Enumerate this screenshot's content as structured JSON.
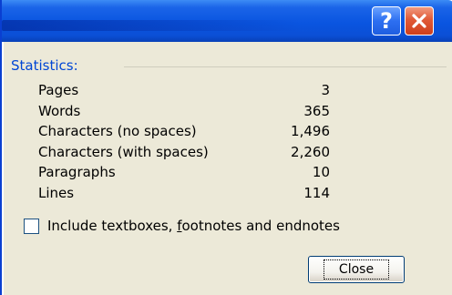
{
  "titlebar": {
    "help_label": "?",
    "close_icon": "close-x-icon"
  },
  "statistics": {
    "heading": "Statistics:",
    "rows": [
      {
        "name": "Pages",
        "value": "3"
      },
      {
        "name": "Words",
        "value": "365"
      },
      {
        "name": "Characters (no spaces)",
        "value": "1,496"
      },
      {
        "name": "Characters (with spaces)",
        "value": "2,260"
      },
      {
        "name": "Paragraphs",
        "value": "10"
      },
      {
        "name": "Lines",
        "value": "114"
      }
    ]
  },
  "include_option": {
    "label_before": "Include textboxes, ",
    "label_accel": "f",
    "label_after": "ootnotes and endnotes",
    "checked": false
  },
  "buttons": {
    "close_label": "Close"
  },
  "colors": {
    "titlebar": "#0a55e0",
    "group_label": "#0046d5",
    "dialog_bg": "#ece9d8",
    "close_red": "#e05a37"
  }
}
